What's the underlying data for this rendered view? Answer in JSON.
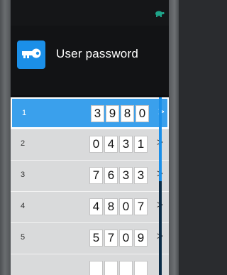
{
  "header": {
    "title": "User password",
    "key_icon": "key-icon"
  },
  "status": {
    "icon": "turtle-icon",
    "color": "#1fa58a"
  },
  "colors": {
    "accent": "#1b8fe8",
    "selected_row": "#3aa0ec"
  },
  "list": {
    "selected_index": 0,
    "rows": [
      {
        "number": "1",
        "digits": [
          "3",
          "9",
          "8",
          "0"
        ],
        "chevron": ">"
      },
      {
        "number": "2",
        "digits": [
          "0",
          "4",
          "3",
          "1"
        ],
        "chevron": ">"
      },
      {
        "number": "3",
        "digits": [
          "7",
          "6",
          "3",
          "3"
        ],
        "chevron": ">"
      },
      {
        "number": "4",
        "digits": [
          "4",
          "8",
          "0",
          "7"
        ],
        "chevron": ">"
      },
      {
        "number": "5",
        "digits": [
          "5",
          "7",
          "0",
          "9"
        ],
        "chevron": ">"
      },
      {
        "number": "",
        "digits": [
          "",
          "",
          "",
          ""
        ],
        "chevron": ""
      }
    ]
  }
}
